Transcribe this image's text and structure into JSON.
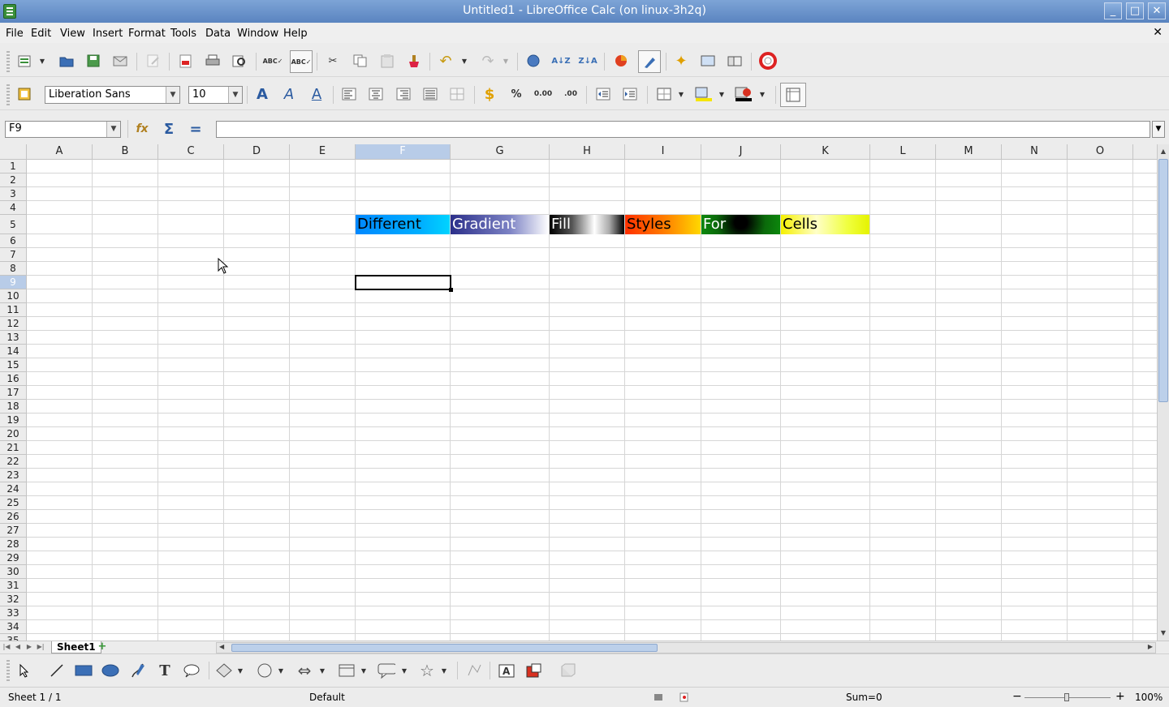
{
  "window": {
    "title": "Untitled1 - LibreOffice Calc (on linux-3h2q)",
    "min": "_",
    "max": "□",
    "close": "✕"
  },
  "menu": [
    "File",
    "Edit",
    "View",
    "Insert",
    "Format",
    "Tools",
    "Data",
    "Window",
    "Help"
  ],
  "menu_close": "✕",
  "formatting": {
    "font_name": "Liberation Sans",
    "font_size": "10"
  },
  "name_box": "F9",
  "formula_value": "",
  "columns": [
    "A",
    "B",
    "C",
    "D",
    "E",
    "F",
    "G",
    "H",
    "I",
    "J",
    "K",
    "L",
    "M",
    "N",
    "O"
  ],
  "rows": [
    "1",
    "2",
    "3",
    "4",
    "5",
    "6",
    "7",
    "8",
    "9",
    "10",
    "11",
    "12",
    "13",
    "14",
    "15",
    "16",
    "17",
    "18",
    "19",
    "20",
    "21",
    "22",
    "23",
    "24",
    "25",
    "26",
    "27",
    "28",
    "29",
    "30",
    "31",
    "32",
    "33",
    "34",
    "35"
  ],
  "selected_column": "F",
  "selected_row": "9",
  "gradient_cells": [
    {
      "text": "Different",
      "col": "F",
      "row": "5",
      "text_color": "#000000"
    },
    {
      "text": "Gradient",
      "col": "G",
      "row": "5",
      "text_color": "#ffffff"
    },
    {
      "text": "Fill",
      "col": "H",
      "row": "5",
      "text_color": "#ffffff"
    },
    {
      "text": "Styles",
      "col": "I",
      "row": "5",
      "text_color": "#000000"
    },
    {
      "text": "For",
      "col": "J",
      "row": "5",
      "text_color": "#ffffff"
    },
    {
      "text": "Cells",
      "col": "K",
      "row": "5",
      "text_color": "#000000"
    }
  ],
  "sheet_tab": "Sheet1",
  "status": {
    "sheet": "Sheet 1 / 1",
    "page_style": "Default",
    "sum": "Sum=0",
    "zoom_minus": "−",
    "zoom_plus": "+",
    "zoom": "100%"
  },
  "colors": {
    "selection_header": "#b8cce8",
    "titlebar": "#6b93cb"
  }
}
